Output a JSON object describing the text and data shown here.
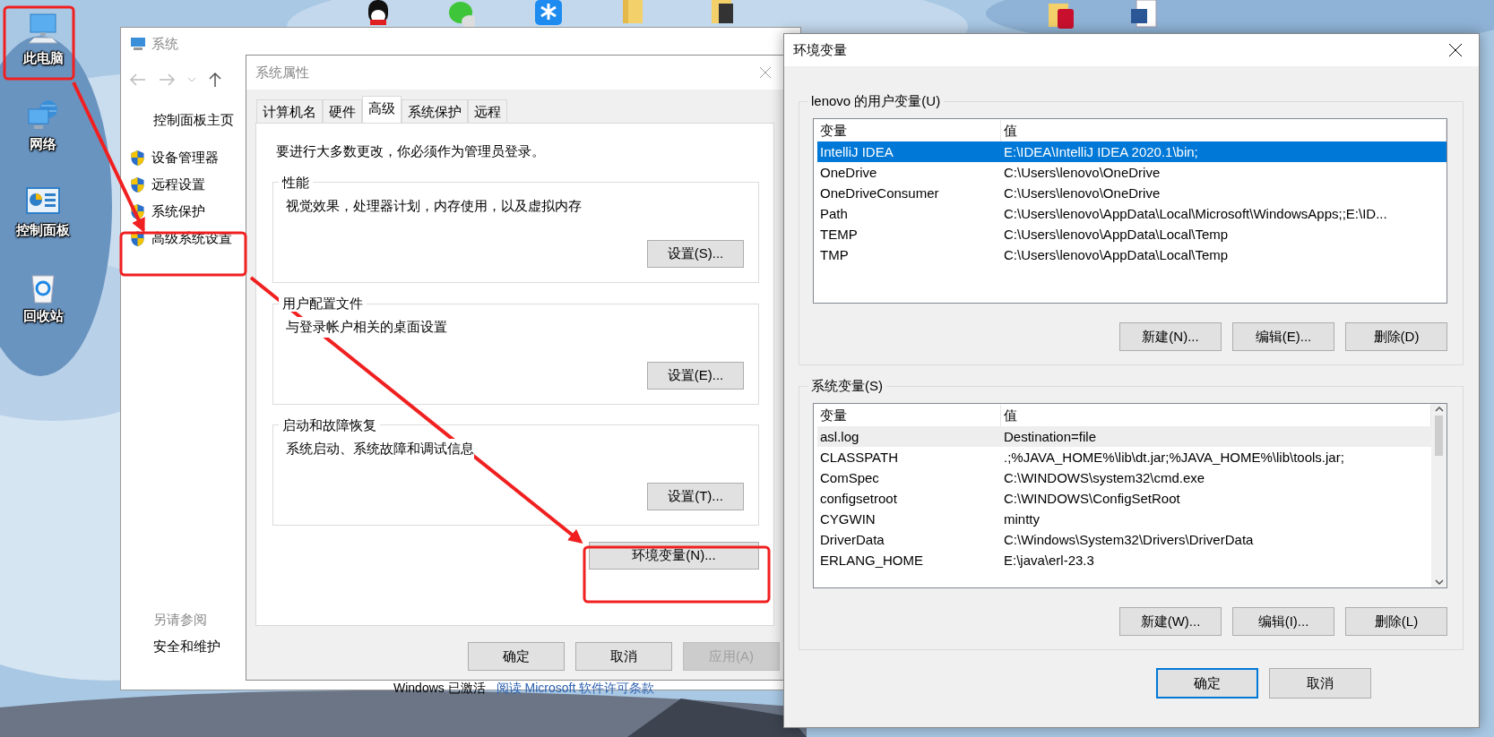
{
  "desktop_icons": [
    {
      "label": "此电脑",
      "kind": "computer"
    },
    {
      "label": "网络",
      "kind": "network"
    },
    {
      "label": "控制面板",
      "kind": "control_panel"
    },
    {
      "label": "回收站",
      "kind": "recycle_bin"
    }
  ],
  "system_window": {
    "title": "系统",
    "sidebar": {
      "home": "控制面板主页",
      "links": [
        "设备管理器",
        "远程设置",
        "系统保护",
        "高级系统设置"
      ]
    },
    "see_also": {
      "heading": "另请参阅",
      "links": [
        "安全和维护"
      ]
    },
    "footer_texts": [
      "Windows 已激活",
      "阅读 Microsoft 软件许可条款"
    ]
  },
  "system_properties": {
    "title": "系统属性",
    "tabs": [
      {
        "label": "计算机名",
        "selected": false
      },
      {
        "label": "硬件",
        "selected": false
      },
      {
        "label": "高级",
        "selected": true
      },
      {
        "label": "系统保护",
        "selected": false
      },
      {
        "label": "远程",
        "selected": false
      }
    ],
    "notice": "要进行大多数更改，你必须作为管理员登录。",
    "groups": [
      {
        "title": "性能",
        "description": "视觉效果，处理器计划，内存使用，以及虚拟内存",
        "button": "设置(S)..."
      },
      {
        "title": "用户配置文件",
        "description": "与登录帐户相关的桌面设置",
        "button": "设置(E)..."
      },
      {
        "title": "启动和故障恢复",
        "description": "系统启动、系统故障和调试信息",
        "button": "设置(T)..."
      }
    ],
    "env_button": "环境变量(N)...",
    "buttons": [
      {
        "label": "确定",
        "disabled": false
      },
      {
        "label": "取消",
        "disabled": false
      },
      {
        "label": "应用(A)",
        "disabled": true
      }
    ]
  },
  "env_dialog": {
    "title": "环境变量",
    "sections": [
      {
        "title": "lenovo 的用户变量(U)",
        "columns": [
          "变量",
          "值"
        ],
        "scrollbar": false,
        "rows": [
          {
            "name": "IntelliJ IDEA",
            "value": "E:\\IDEA\\IntelliJ IDEA 2020.1\\bin;",
            "selected": true,
            "highlighted": false
          },
          {
            "name": "OneDrive",
            "value": "C:\\Users\\lenovo\\OneDrive",
            "selected": false,
            "highlighted": false
          },
          {
            "name": "OneDriveConsumer",
            "value": "C:\\Users\\lenovo\\OneDrive",
            "selected": false,
            "highlighted": false
          },
          {
            "name": "Path",
            "value": "C:\\Users\\lenovo\\AppData\\Local\\Microsoft\\WindowsApps;;E:\\ID...",
            "selected": false,
            "highlighted": false
          },
          {
            "name": "TEMP",
            "value": "C:\\Users\\lenovo\\AppData\\Local\\Temp",
            "selected": false,
            "highlighted": false
          },
          {
            "name": "TMP",
            "value": "C:\\Users\\lenovo\\AppData\\Local\\Temp",
            "selected": false,
            "highlighted": false
          }
        ],
        "buttons": [
          {
            "label": "新建(N)..."
          },
          {
            "label": "编辑(E)..."
          },
          {
            "label": "删除(D)"
          }
        ]
      },
      {
        "title": "系统变量(S)",
        "columns": [
          "变量",
          "值"
        ],
        "scrollbar": true,
        "rows": [
          {
            "name": "asl.log",
            "value": "Destination=file",
            "selected": false,
            "highlighted": true
          },
          {
            "name": "CLASSPATH",
            "value": ".;%JAVA_HOME%\\lib\\dt.jar;%JAVA_HOME%\\lib\\tools.jar;",
            "selected": false,
            "highlighted": false
          },
          {
            "name": "ComSpec",
            "value": "C:\\WINDOWS\\system32\\cmd.exe",
            "selected": false,
            "highlighted": false
          },
          {
            "name": "configsetroot",
            "value": "C:\\WINDOWS\\ConfigSetRoot",
            "selected": false,
            "highlighted": false
          },
          {
            "name": "CYGWIN",
            "value": "mintty",
            "selected": false,
            "highlighted": false
          },
          {
            "name": "DriverData",
            "value": "C:\\Windows\\System32\\Drivers\\DriverData",
            "selected": false,
            "highlighted": false
          },
          {
            "name": "ERLANG_HOME",
            "value": "E:\\java\\erl-23.3",
            "selected": false,
            "highlighted": false
          }
        ],
        "buttons": [
          {
            "label": "新建(W)..."
          },
          {
            "label": "编辑(I)..."
          },
          {
            "label": "删除(L)"
          }
        ]
      }
    ],
    "buttons": [
      {
        "label": "确定",
        "default": true
      },
      {
        "label": "取消",
        "default": false
      }
    ]
  }
}
